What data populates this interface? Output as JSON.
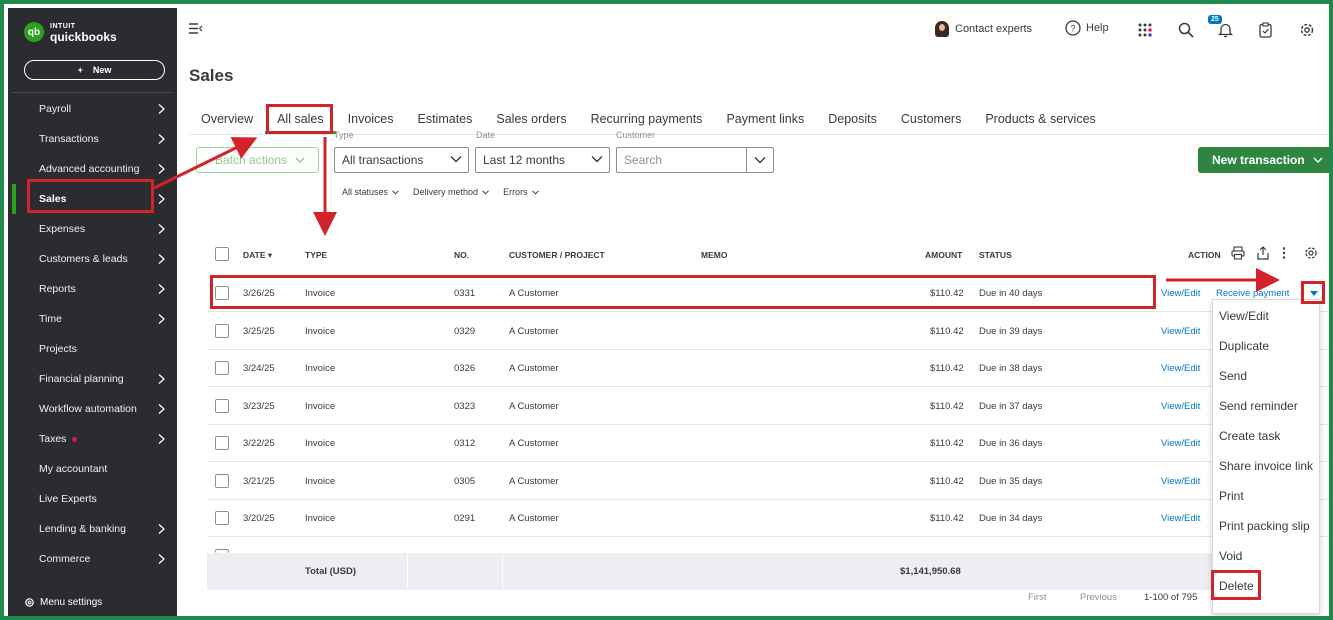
{
  "brand": {
    "small": "INTUIT",
    "big": "quickbooks",
    "mark": "qb"
  },
  "sidebar": {
    "new_label": "New",
    "new_plus": "+",
    "items": [
      {
        "label": "Payroll",
        "chev": true
      },
      {
        "label": "Transactions",
        "chev": true
      },
      {
        "label": "Advanced accounting",
        "chev": true
      },
      {
        "label": "Sales",
        "chev": true,
        "active": true
      },
      {
        "label": "Expenses",
        "chev": true
      },
      {
        "label": "Customers & leads",
        "chev": true
      },
      {
        "label": "Reports",
        "chev": true
      },
      {
        "label": "Time",
        "chev": true
      },
      {
        "label": "Projects",
        "chev": false
      },
      {
        "label": "Financial planning",
        "chev": true
      },
      {
        "label": "Workflow automation",
        "chev": true
      },
      {
        "label": "Taxes",
        "chev": true,
        "dot": true
      },
      {
        "label": "My accountant",
        "chev": false
      },
      {
        "label": "Live Experts",
        "chev": false
      },
      {
        "label": "Lending & banking",
        "chev": true
      },
      {
        "label": "Commerce",
        "chev": true
      }
    ],
    "menu_settings": "Menu settings"
  },
  "topbar": {
    "contact": "Contact experts",
    "help": "Help",
    "notifications": "25"
  },
  "page": {
    "title": "Sales"
  },
  "tabs": [
    "Overview",
    "All sales",
    "Invoices",
    "Estimates",
    "Sales orders",
    "Recurring payments",
    "Payment links",
    "Deposits",
    "Customers",
    "Products & services"
  ],
  "filters": {
    "batch_actions": "Batch actions",
    "type_label": "Type",
    "type_value": "All transactions",
    "date_label": "Date",
    "date_value": "Last 12 months",
    "customer_label": "Customer",
    "customer_placeholder": "Search",
    "new_transaction": "New transaction",
    "statuses": "All statuses",
    "delivery": "Delivery method",
    "errors": "Errors"
  },
  "table": {
    "headers": {
      "date": "DATE",
      "type": "TYPE",
      "no": "NO.",
      "customer": "CUSTOMER / PROJECT",
      "memo": "MEMO",
      "amount": "AMOUNT",
      "status": "STATUS",
      "action": "ACTION"
    },
    "rows": [
      {
        "date": "3/26/25",
        "type": "Invoice",
        "no": "0331",
        "customer": "A Customer",
        "amount": "$110.42",
        "status": "Due in 40 days",
        "view": "View/Edit",
        "action": "Receive payment"
      },
      {
        "date": "3/25/25",
        "type": "Invoice",
        "no": "0329",
        "customer": "A Customer",
        "amount": "$110.42",
        "status": "Due in 39 days",
        "view": "View/Edit"
      },
      {
        "date": "3/24/25",
        "type": "Invoice",
        "no": "0326",
        "customer": "A Customer",
        "amount": "$110.42",
        "status": "Due in 38 days",
        "view": "View/Edit"
      },
      {
        "date": "3/23/25",
        "type": "Invoice",
        "no": "0323",
        "customer": "A Customer",
        "amount": "$110.42",
        "status": "Due in 37 days",
        "view": "View/Edit"
      },
      {
        "date": "3/22/25",
        "type": "Invoice",
        "no": "0312",
        "customer": "A Customer",
        "amount": "$110.42",
        "status": "Due in 36 days",
        "view": "View/Edit"
      },
      {
        "date": "3/21/25",
        "type": "Invoice",
        "no": "0305",
        "customer": "A Customer",
        "amount": "$110.42",
        "status": "Due in 35 days",
        "view": "View/Edit"
      },
      {
        "date": "3/20/25",
        "type": "Invoice",
        "no": "0291",
        "customer": "A Customer",
        "amount": "$110.42",
        "status": "Due in 34 days",
        "view": "View/Edit"
      }
    ],
    "total_label": "Total (USD)",
    "total_value": "$1,141,950.68"
  },
  "pager": {
    "first": "First",
    "previous": "Previous",
    "range": "1-100 of 795"
  },
  "action_menu": [
    "View/Edit",
    "Duplicate",
    "Send",
    "Send reminder",
    "Create task",
    "Share invoice link",
    "Print",
    "Print packing slip",
    "Void",
    "Delete"
  ],
  "colors": {
    "accent": "#2ca01c",
    "link": "#0077c5",
    "annotation": "#d2232a",
    "sidebar": "#2b2c2f"
  }
}
